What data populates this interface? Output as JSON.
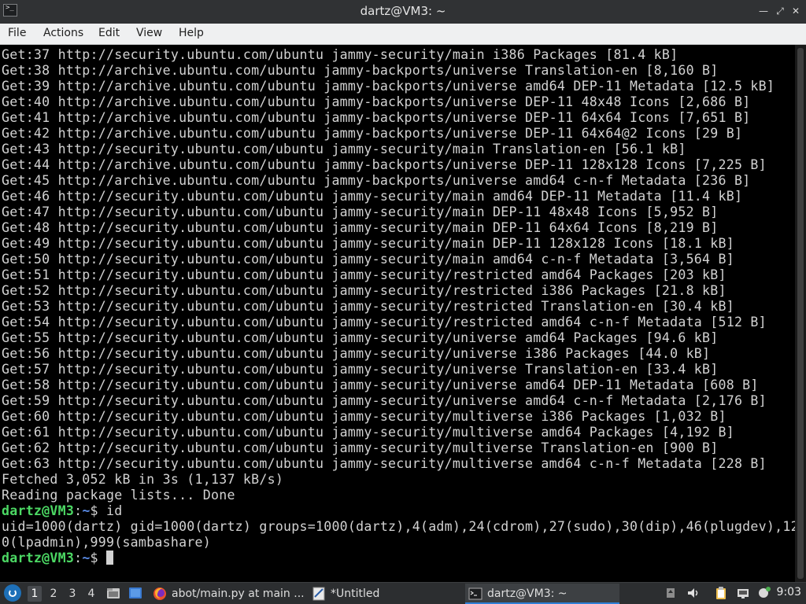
{
  "window": {
    "title": "dartz@VM3: ~",
    "app_icon_glyph": ">_",
    "controls": {
      "minimize": "—",
      "restore": "⤢",
      "close": "✕"
    }
  },
  "menubar": {
    "file": "File",
    "actions": "Actions",
    "edit": "Edit",
    "view": "View",
    "help": "Help"
  },
  "terminal": {
    "lines": [
      "Get:37 http://security.ubuntu.com/ubuntu jammy-security/main i386 Packages [81.4 kB]",
      "Get:38 http://archive.ubuntu.com/ubuntu jammy-backports/universe Translation-en [8,160 B]",
      "Get:39 http://archive.ubuntu.com/ubuntu jammy-backports/universe amd64 DEP-11 Metadata [12.5 kB]",
      "Get:40 http://archive.ubuntu.com/ubuntu jammy-backports/universe DEP-11 48x48 Icons [2,686 B]",
      "Get:41 http://archive.ubuntu.com/ubuntu jammy-backports/universe DEP-11 64x64 Icons [7,651 B]",
      "Get:42 http://archive.ubuntu.com/ubuntu jammy-backports/universe DEP-11 64x64@2 Icons [29 B]",
      "Get:43 http://security.ubuntu.com/ubuntu jammy-security/main Translation-en [56.1 kB]",
      "Get:44 http://archive.ubuntu.com/ubuntu jammy-backports/universe DEP-11 128x128 Icons [7,225 B]",
      "Get:45 http://archive.ubuntu.com/ubuntu jammy-backports/universe amd64 c-n-f Metadata [236 B]",
      "Get:46 http://security.ubuntu.com/ubuntu jammy-security/main amd64 DEP-11 Metadata [11.4 kB]",
      "Get:47 http://security.ubuntu.com/ubuntu jammy-security/main DEP-11 48x48 Icons [5,952 B]",
      "Get:48 http://security.ubuntu.com/ubuntu jammy-security/main DEP-11 64x64 Icons [8,219 B]",
      "Get:49 http://security.ubuntu.com/ubuntu jammy-security/main DEP-11 128x128 Icons [18.1 kB]",
      "Get:50 http://security.ubuntu.com/ubuntu jammy-security/main amd64 c-n-f Metadata [3,564 B]",
      "Get:51 http://security.ubuntu.com/ubuntu jammy-security/restricted amd64 Packages [203 kB]",
      "Get:52 http://security.ubuntu.com/ubuntu jammy-security/restricted i386 Packages [21.8 kB]",
      "Get:53 http://security.ubuntu.com/ubuntu jammy-security/restricted Translation-en [30.4 kB]",
      "Get:54 http://security.ubuntu.com/ubuntu jammy-security/restricted amd64 c-n-f Metadata [512 B]",
      "Get:55 http://security.ubuntu.com/ubuntu jammy-security/universe amd64 Packages [94.6 kB]",
      "Get:56 http://security.ubuntu.com/ubuntu jammy-security/universe i386 Packages [44.0 kB]",
      "Get:57 http://security.ubuntu.com/ubuntu jammy-security/universe Translation-en [33.4 kB]",
      "Get:58 http://security.ubuntu.com/ubuntu jammy-security/universe amd64 DEP-11 Metadata [608 B]",
      "Get:59 http://security.ubuntu.com/ubuntu jammy-security/universe amd64 c-n-f Metadata [2,176 B]",
      "Get:60 http://security.ubuntu.com/ubuntu jammy-security/multiverse i386 Packages [1,032 B]",
      "Get:61 http://security.ubuntu.com/ubuntu jammy-security/multiverse amd64 Packages [4,192 B]",
      "Get:62 http://security.ubuntu.com/ubuntu jammy-security/multiverse Translation-en [900 B]",
      "Get:63 http://security.ubuntu.com/ubuntu jammy-security/multiverse amd64 c-n-f Metadata [228 B]",
      "Fetched 3,052 kB in 3s (1,137 kB/s)",
      "Reading package lists... Done"
    ],
    "prompt_user": "dartz@VM3",
    "prompt_sep": ":",
    "prompt_path": "~",
    "prompt_dollar": "$ ",
    "command": "id",
    "output": [
      "uid=1000(dartz) gid=1000(dartz) groups=1000(dartz),4(adm),24(cdrom),27(sudo),30(dip),46(plugdev),12",
      "0(lpadmin),999(sambashare)"
    ],
    "prompt_color_user": "#4cd964",
    "prompt_color_path": "#5a8ce8"
  },
  "taskbar": {
    "workspaces": [
      "1",
      "2",
      "3",
      "4"
    ],
    "active_workspace": "1",
    "tasks": [
      {
        "label": "abot/main.py at main ...",
        "icon": "firefox-icon"
      },
      {
        "label": "*Untitled",
        "icon": "text-editor-icon"
      },
      {
        "label": "dartz@VM3: ~",
        "icon": "terminal-icon"
      }
    ],
    "clock": "9:03"
  }
}
